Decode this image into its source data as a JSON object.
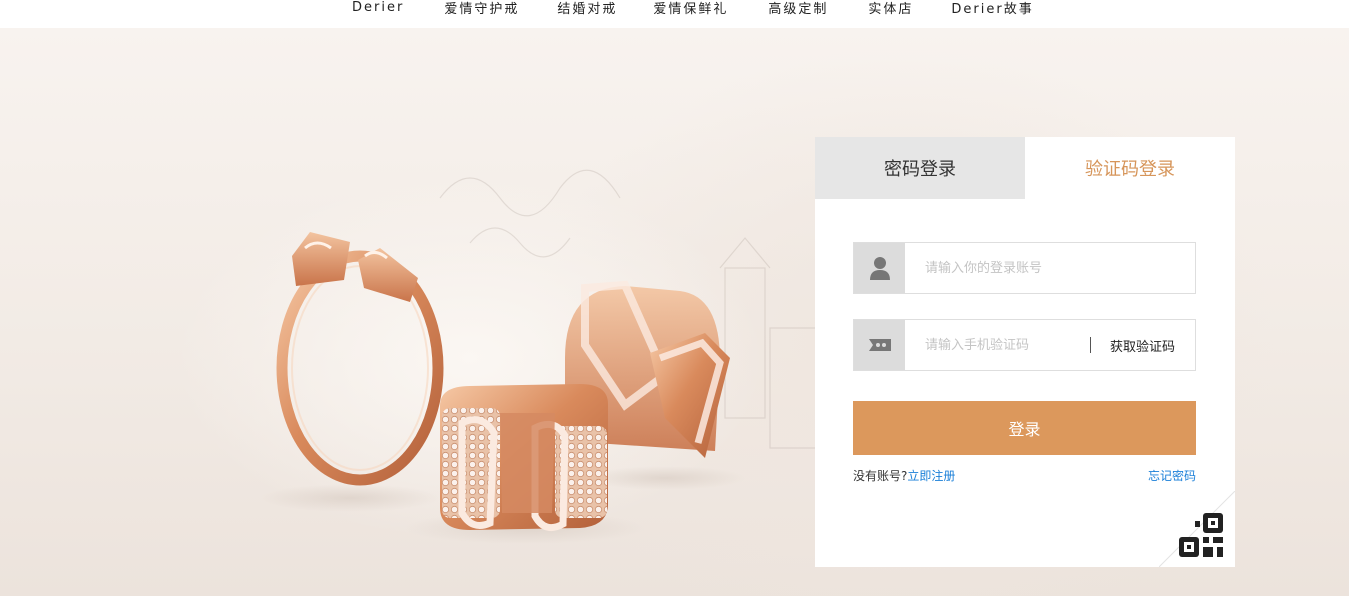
{
  "nav": {
    "items": [
      {
        "label": "Derier"
      },
      {
        "label": "爱情守护戒"
      },
      {
        "label": "结婚对戒"
      },
      {
        "label": "爱情保鲜礼"
      },
      {
        "label": "高级定制"
      },
      {
        "label": "实体店"
      },
      {
        "label": "Derier故事"
      }
    ]
  },
  "login": {
    "tabs": [
      {
        "label": "密码登录",
        "active": false
      },
      {
        "label": "验证码登录",
        "active": true
      }
    ],
    "account_input": {
      "placeholder": "请输入你的登录账号",
      "value": "",
      "icon": "user-icon"
    },
    "code_input": {
      "placeholder": "请输入手机验证码",
      "value": "",
      "icon": "message-icon"
    },
    "get_code_label": "获取验证码",
    "submit_label": "登录",
    "no_account_text": "没有账号?",
    "register_label": "立即注册",
    "forgot_label": "忘记密码",
    "qr_icon": "qr-code-icon"
  },
  "colors": {
    "accent": "#dc985c",
    "active_tab_text": "#d6955a",
    "link": "#1a7fd8",
    "inactive_tab_bg": "#e6e6e6"
  }
}
